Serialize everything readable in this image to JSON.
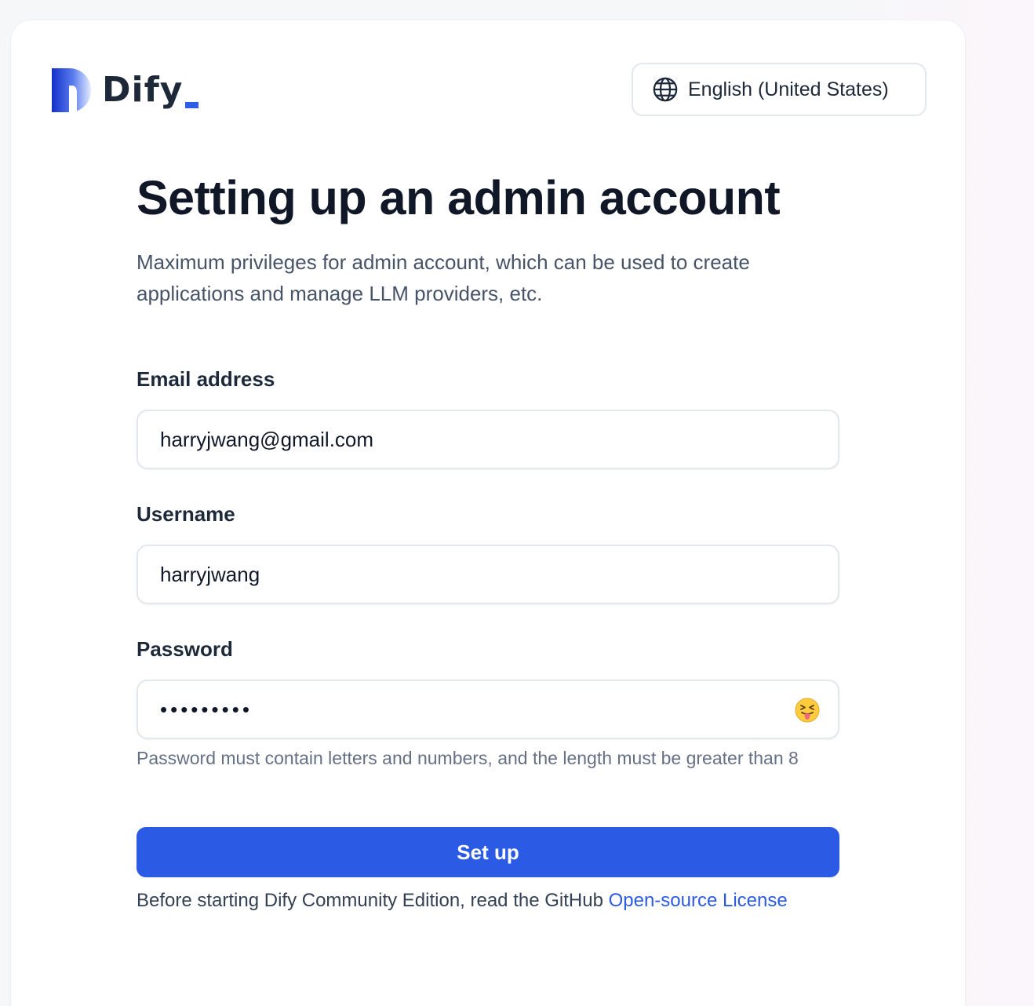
{
  "brand": {
    "name": "Dify",
    "accent_color": "#2d5ee9"
  },
  "language_selector": {
    "icon": "globe-icon",
    "label": "English (United States)"
  },
  "header": {
    "title": "Setting up an admin account",
    "subtitle": "Maximum privileges for admin account, which can be used to create applications and manage LLM providers, etc."
  },
  "form": {
    "email": {
      "label": "Email address",
      "value": "harryjwang@gmail.com"
    },
    "username": {
      "label": "Username",
      "value": "harryjwang"
    },
    "password": {
      "label": "Password",
      "masked_value": "•••••••••",
      "toggle_icon": "tongue-emoji-icon",
      "hint": "Password must contain letters and numbers, and the length must be greater than 8"
    },
    "submit_label": "Set up"
  },
  "footer": {
    "text": "Before starting Dify Community Edition, read the GitHub ",
    "link_text": "Open-source License",
    "link_color": "#2b5be4"
  }
}
